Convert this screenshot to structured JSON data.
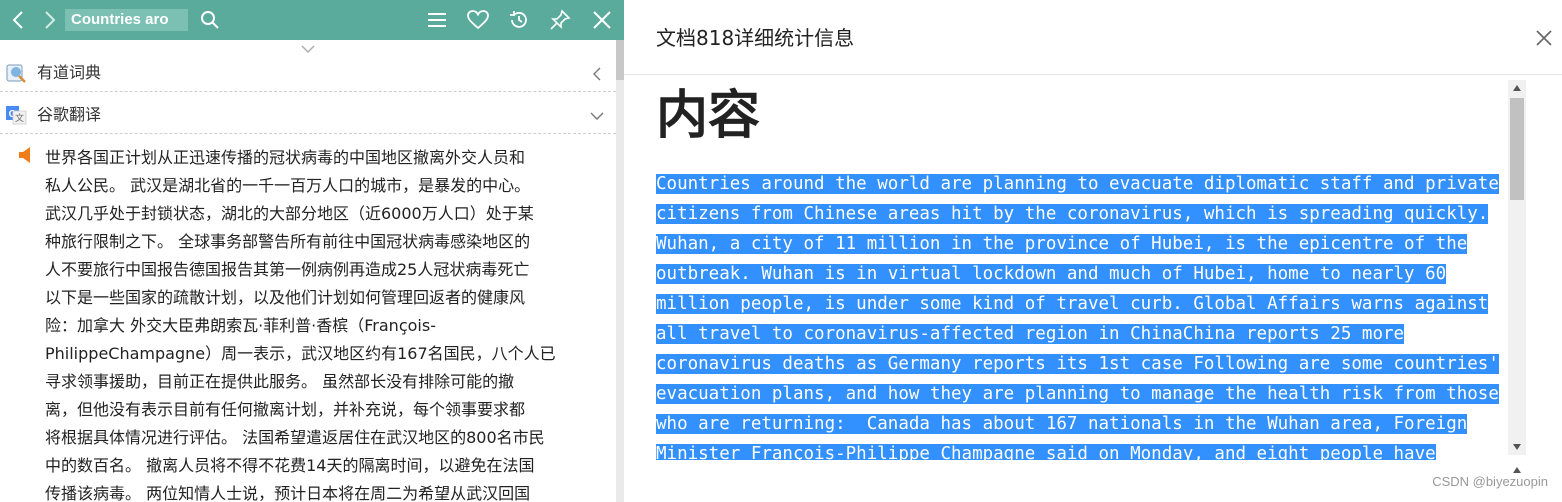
{
  "toolbar": {
    "search_value": "Countries aro",
    "icons": [
      "back-icon",
      "forward-icon",
      "search-icon",
      "menu-icon",
      "heart-icon",
      "history-icon",
      "pin-icon",
      "close-icon"
    ],
    "color": "#5aab9c"
  },
  "sections": [
    {
      "label": "有道词典",
      "icon": "youdao-dict-icon",
      "state": "collapsed"
    },
    {
      "label": "谷歌翻译",
      "icon": "google-translate-icon",
      "state": "expanded"
    }
  ],
  "translation": {
    "lines": [
      "世界各国正计划从正迅速传播的冠状病毒的中国地区撤离外交人员和",
      "私人公民。 武汉是湖北省的一千一百万人口的城市，是暴发的中心。",
      "武汉几乎处于封锁状态，湖北的大部分地区（近6000万人口）处于某",
      "种旅行限制之下。 全球事务部警告所有前往中国冠状病毒感染地区的",
      "人不要旅行中国报告德国报告其第一例病例再造成25人冠状病毒死亡",
      "以下是一些国家的疏散计划，以及他们计划如何管理回返者的健康风",
      "险：加拿大 外交大臣弗朗索瓦·菲利普·香槟（François-",
      "PhilippeChampagne）周一表示，武汉地区约有167名国民，八个人已",
      "寻求领事援助，目前正在提供此服务。 虽然部长没有排除可能的撤",
      "离，但他没有表示目前有任何撤离计划，并补充说，每个领事要求都",
      "将根据具体情况进行评估。 法国希望遣返居住在武汉地区的800名市民",
      "中的数百名。 撤离人员将不得不花费14天的隔离时间，以避免在法国",
      "传播该病毒。 两位知情人士说，预计日本将在周二为希望从武汉回国"
    ]
  },
  "dialog": {
    "title": "文档818详细统计信息",
    "heading": "内容",
    "lines": [
      "Countries around the world are planning to evacuate diplomatic staff and private",
      "citizens from Chinese areas hit by the coronavirus, which is spreading quickly.",
      "Wuhan, a city of 11 million in the province of Hubei, is the epicentre of the",
      "outbreak. Wuhan is in virtual lockdown and much of Hubei, home to nearly 60",
      "million people, is under some kind of travel curb. Global Affairs warns against",
      "all travel to coronavirus-affected region in ChinaChina reports 25 more",
      "coronavirus deaths as Germany reports its 1st case Following are some countries'",
      "evacuation plans, and how they are planning to manage the health risk from those",
      "who are returning:  Canada has about 167 nationals in the Wuhan area, Foreign",
      "Minister François-Philippe Champagne said on Monday, and eight people have"
    ],
    "selection_color": "#3390ff"
  },
  "watermark": "CSDN @biyezuopin"
}
